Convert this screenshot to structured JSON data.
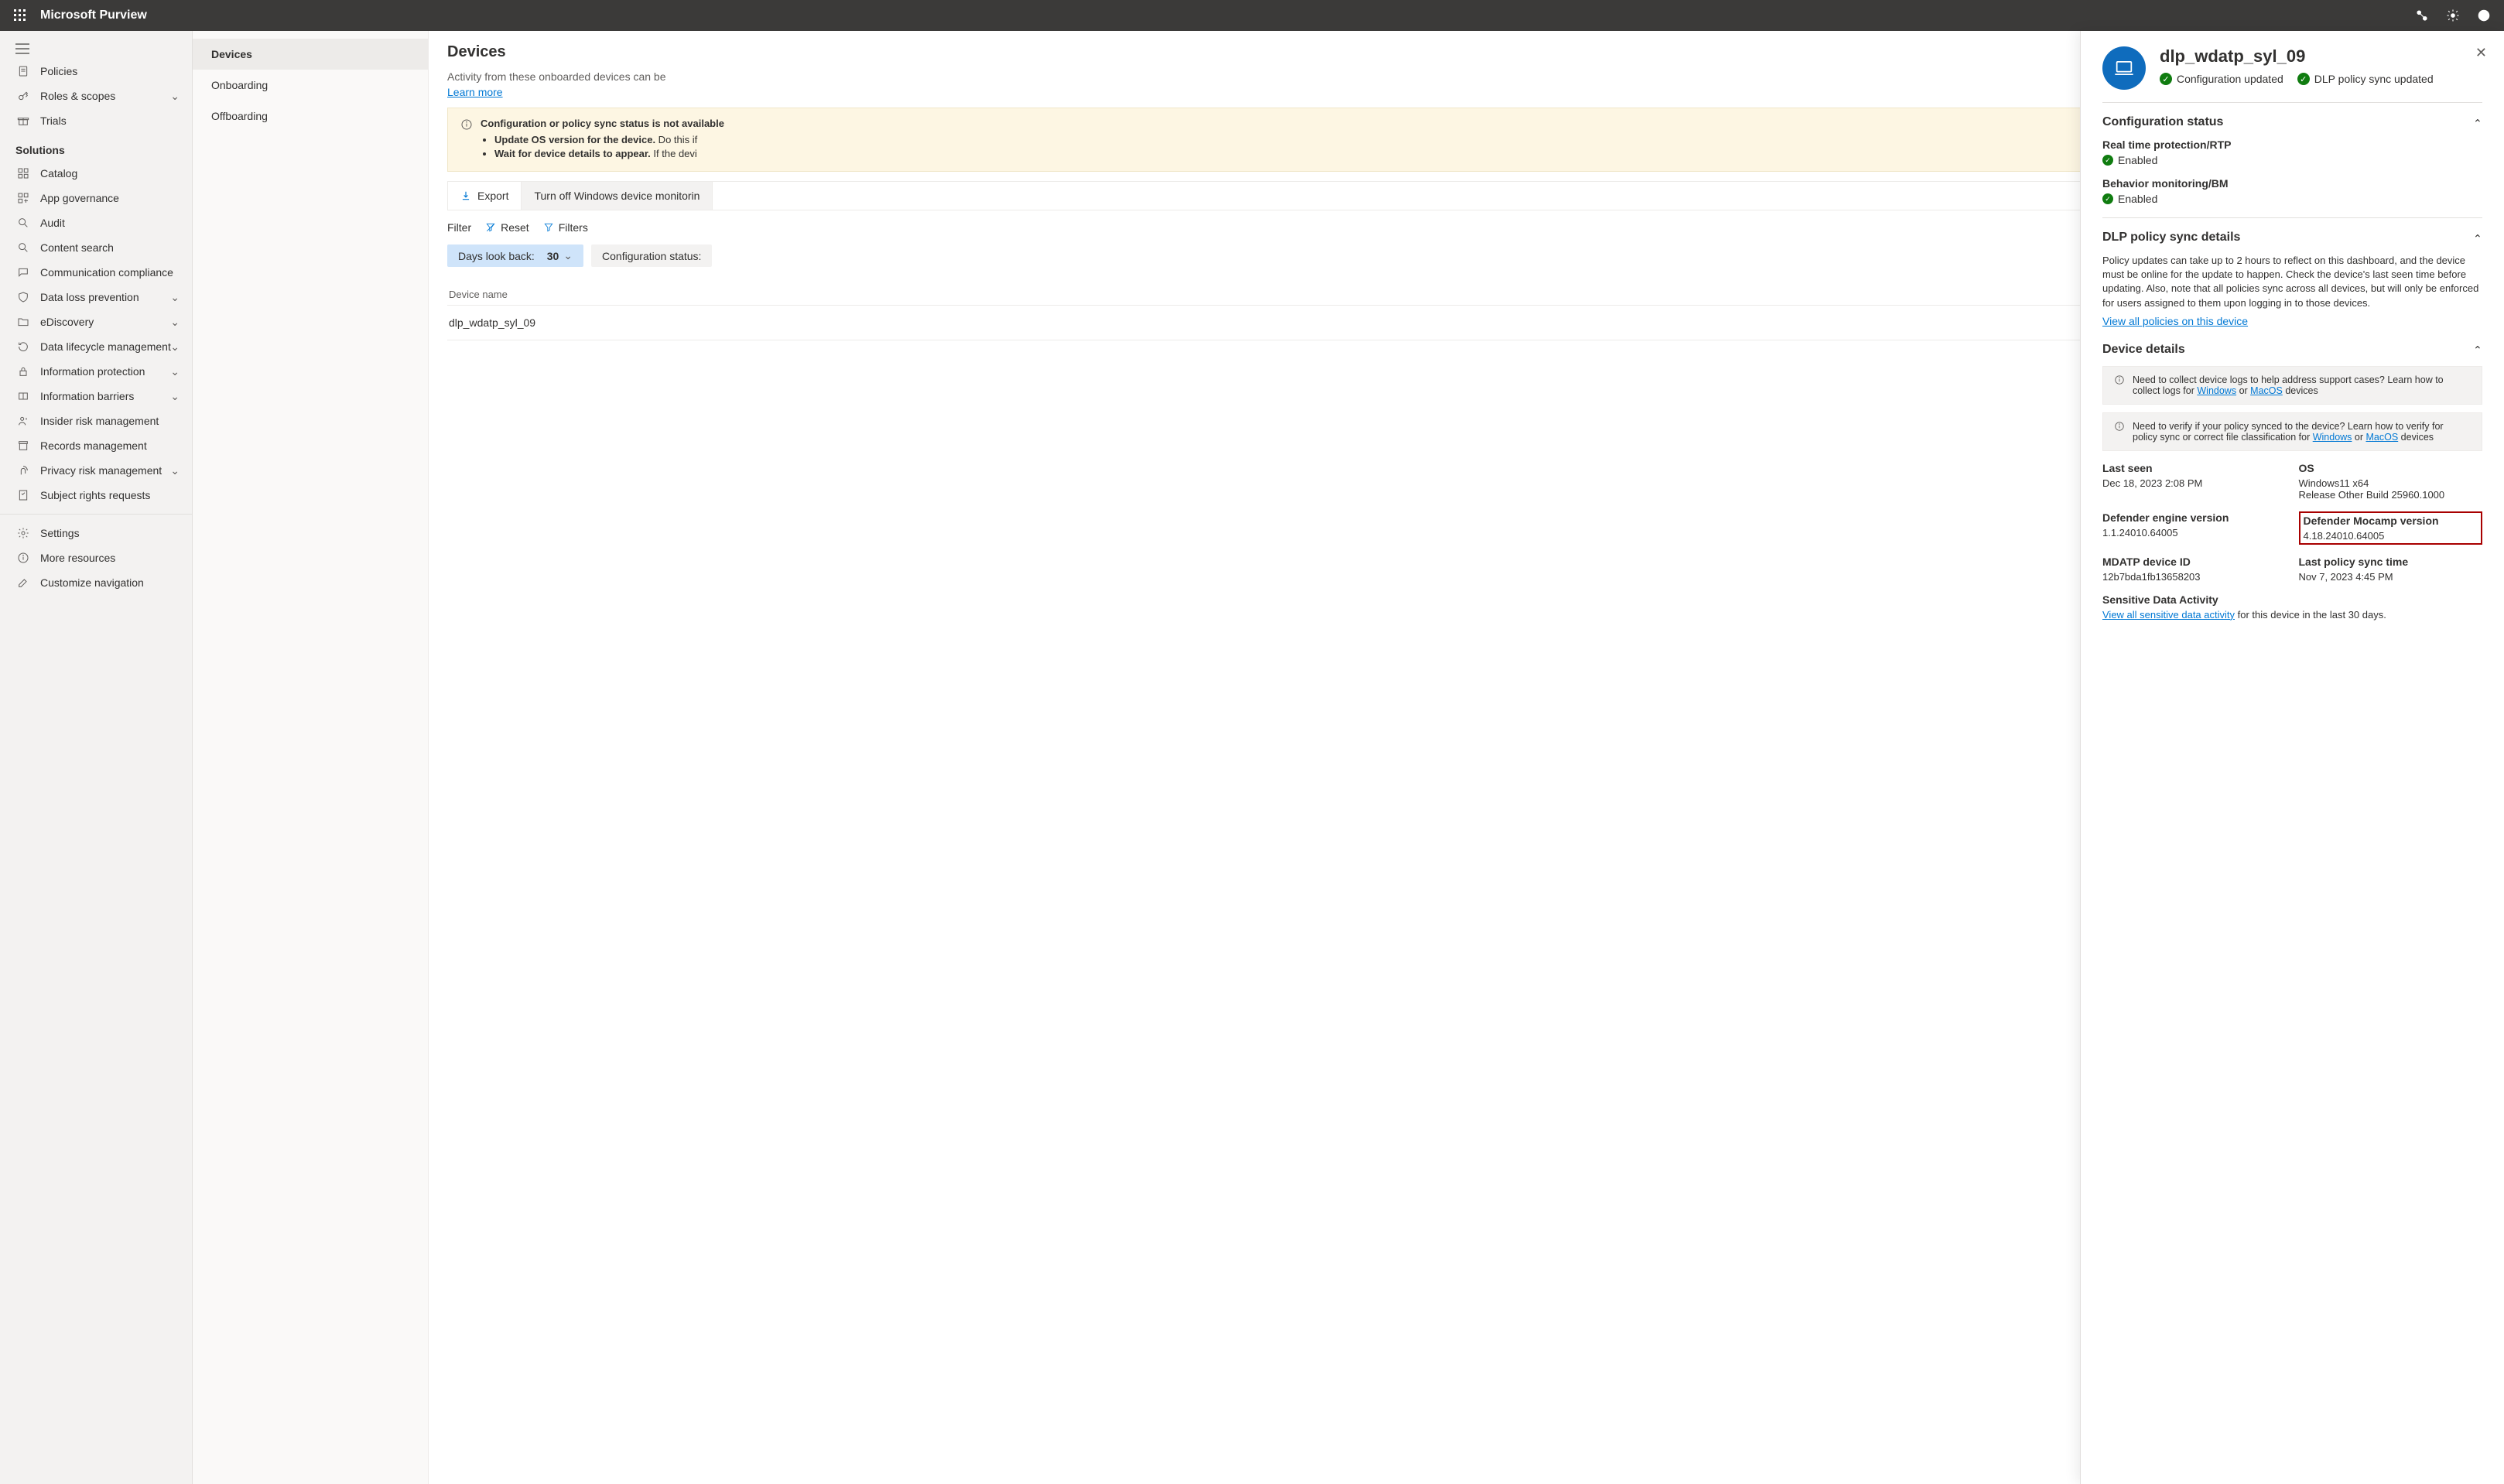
{
  "header": {
    "brand": "Microsoft Purview"
  },
  "sidebar": {
    "top": [
      {
        "label": "Policies"
      },
      {
        "label": "Roles & scopes"
      },
      {
        "label": "Trials"
      }
    ],
    "section_label": "Solutions",
    "items": [
      {
        "label": "Catalog"
      },
      {
        "label": "App governance"
      },
      {
        "label": "Audit"
      },
      {
        "label": "Content search"
      },
      {
        "label": "Communication compliance"
      },
      {
        "label": "Data loss prevention"
      },
      {
        "label": "eDiscovery"
      },
      {
        "label": "Data lifecycle management"
      },
      {
        "label": "Information protection"
      },
      {
        "label": "Information barriers"
      },
      {
        "label": "Insider risk management"
      },
      {
        "label": "Records management"
      },
      {
        "label": "Privacy risk management"
      },
      {
        "label": "Subject rights requests"
      }
    ],
    "bottom": [
      {
        "label": "Settings"
      },
      {
        "label": "More resources"
      },
      {
        "label": "Customize navigation"
      }
    ]
  },
  "subnav": {
    "items": [
      "Devices",
      "Onboarding",
      "Offboarding"
    ]
  },
  "main": {
    "title": "Devices",
    "help": "Activity from these onboarded devices can be",
    "learn_more": "Learn more",
    "info_title": "Configuration or policy sync status is not available",
    "info_b1a": "Update OS version for the device.",
    "info_b1b": " Do this if",
    "info_b2a": "Wait for device details to appear.",
    "info_b2b": " If the devi",
    "export": "Export",
    "toggle": "Turn off Windows device monitorin",
    "filter_label": "Filter",
    "reset": "Reset",
    "filters": "Filters",
    "lookback_label": "Days look back:",
    "lookback_value": "30",
    "config_status_label": "Configuration status:",
    "col_device": "Device name",
    "row1": "dlp_wdatp_syl_09"
  },
  "panel": {
    "title": "dlp_wdatp_syl_09",
    "tag1": "Configuration updated",
    "tag2": "DLP policy sync updated",
    "sec_config": "Configuration status",
    "rtp_label": "Real time protection/RTP",
    "rtp_val": "Enabled",
    "bm_label": "Behavior monitoring/BM",
    "bm_val": "Enabled",
    "sec_sync": "DLP policy sync details",
    "sync_para": "Policy updates can take up to 2 hours to reflect on this dashboard, and the device must be online for the update to happen. Check the device's last seen time before updating. Also, note that all policies sync across all devices, but will only be enforced for users assigned to them upon logging in to those devices.",
    "sync_link": "View all policies on this device",
    "sec_details": "Device details",
    "tip1_pre": "Need to collect device logs to help address support cases? Learn how to collect logs for ",
    "tip1_win": "Windows",
    "tip1_or": " or ",
    "tip1_mac": "MacOS",
    "tip1_suf": " devices",
    "tip2_pre": "Need to verify if your policy synced to the device? Learn how to verify for policy sync or correct file classification for ",
    "tip2_win": "Windows",
    "tip2_or": " or ",
    "tip2_mac": "MacOS",
    "tip2_suf": " devices",
    "last_seen_l": "Last seen",
    "last_seen_v": "Dec 18, 2023 2:08 PM",
    "os_l": "OS",
    "os_v1": "Windows11 x64",
    "os_v2": "Release Other Build 25960.1000",
    "eng_l": "Defender engine version",
    "eng_v": "1.1.24010.64005",
    "mocamp_l": "Defender Mocamp version",
    "mocamp_v": "4.18.24010.64005",
    "mdatp_l": "MDATP device ID",
    "mdatp_v": "12b7bda1fb13658203",
    "lastsync_l": "Last policy sync time",
    "lastsync_v": "Nov 7, 2023 4:45 PM",
    "sens_l": "Sensitive Data Activity",
    "sens_link": "View all sensitive data activity",
    "sens_suf": " for this device in the last 30 days."
  }
}
